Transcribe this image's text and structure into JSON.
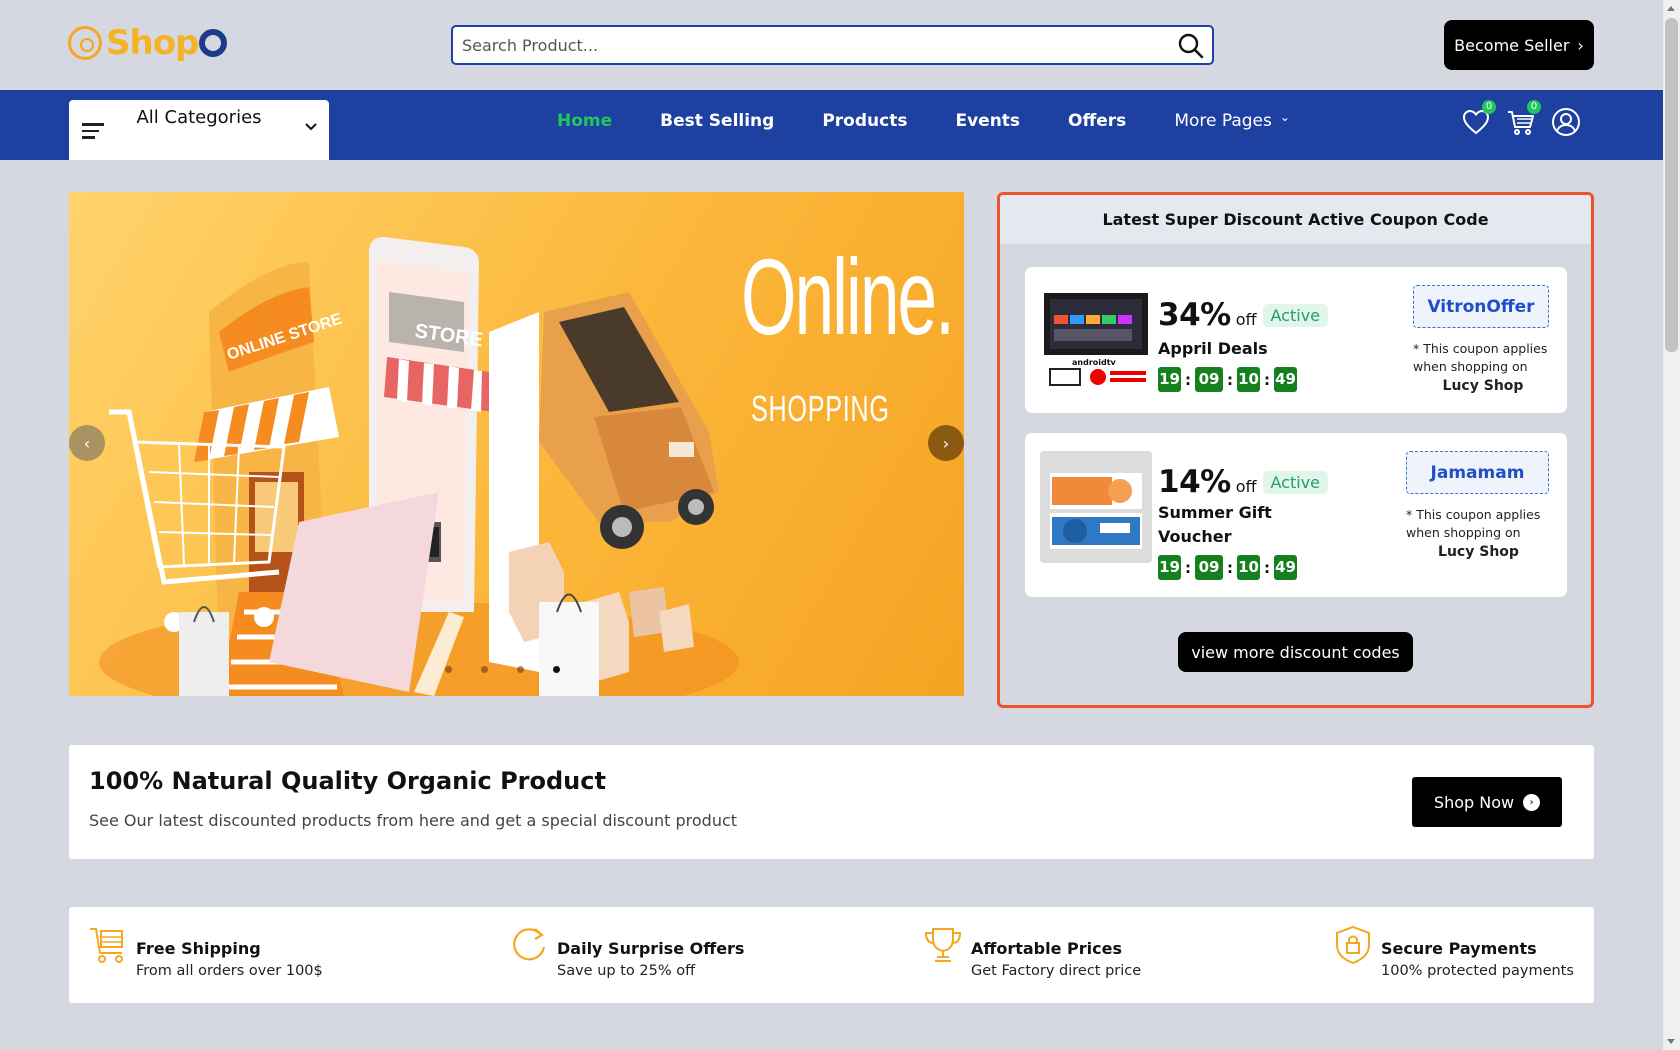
{
  "logo": {
    "text": "Shop"
  },
  "search": {
    "placeholder": "Search Product..."
  },
  "header": {
    "become_seller": "Become Seller"
  },
  "nav": {
    "category_label": "All Categories",
    "links": [
      "Home",
      "Best Selling",
      "Products",
      "Events",
      "Offers",
      "More Pages"
    ],
    "active": "Home",
    "wishlist_count": "0",
    "cart_count": "0"
  },
  "hero": {
    "title": "Online.",
    "subtitle": "SHOPPING",
    "slide_count": 4,
    "active_slide": 4
  },
  "coupons": {
    "heading": "Latest Super Discount Active Coupon Code",
    "items": [
      {
        "percent": "34%",
        "off": "off",
        "status": "Active",
        "name": "Appril Deals",
        "timer": [
          "19",
          "09",
          "10",
          "49"
        ],
        "code": "VitronOffer",
        "note": "* This coupon applies when shopping on",
        "shop": "Lucy Shop",
        "image_icon": "android-tv-image"
      },
      {
        "percent": "14%",
        "off": "off",
        "status": "Active",
        "name": "Summer Gift Voucher",
        "timer": [
          "19",
          "09",
          "10",
          "49"
        ],
        "code": "Jamamam",
        "note": "* This coupon applies when shopping on",
        "shop": "Lucy Shop",
        "image_icon": "gift-voucher-image"
      }
    ],
    "view_more": "view more discount codes"
  },
  "promo": {
    "title": "100% Natural Quality Organic Product",
    "description": "See Our latest discounted products from here and get a special discount product",
    "button": "Shop Now"
  },
  "features": [
    {
      "icon": "shipping-cart-icon",
      "title": "Free Shipping",
      "description": "From all orders over 100$"
    },
    {
      "icon": "refresh-icon",
      "title": "Daily Surprise Offers",
      "description": "Save up to 25% off"
    },
    {
      "icon": "trophy-icon",
      "title": "Affortable Prices",
      "description": "Get Factory direct price"
    },
    {
      "icon": "shield-lock-icon",
      "title": "Secure Payments",
      "description": "100% protected payments"
    }
  ],
  "colors": {
    "nav_bar": "#1e40a0",
    "accent_green": "#22c55e",
    "coupon_border": "#f0522e",
    "logo_yellow": "#f5b225",
    "timer_green": "#16801f"
  }
}
